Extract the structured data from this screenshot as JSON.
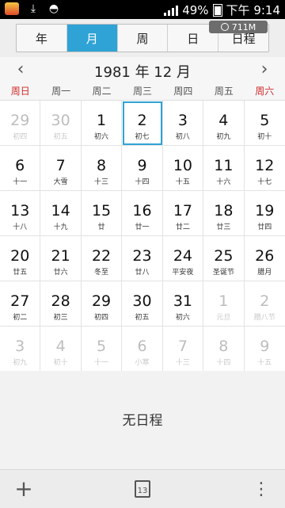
{
  "status": {
    "battery": "49%",
    "time": "下午 9:14"
  },
  "tabs": [
    {
      "label": "年",
      "active": false
    },
    {
      "label": "月",
      "active": true
    },
    {
      "label": "周",
      "active": false
    },
    {
      "label": "日",
      "active": false
    },
    {
      "label": "日程",
      "active": false
    }
  ],
  "memory_badge": "711M",
  "month_title": "1981 年 12 月",
  "weekdays": [
    "周日",
    "周一",
    "周二",
    "周三",
    "周四",
    "周五",
    "周六"
  ],
  "weeks": [
    [
      {
        "d": "29",
        "l": "初四",
        "dim": true
      },
      {
        "d": "30",
        "l": "初五",
        "dim": true
      },
      {
        "d": "1",
        "l": "初六"
      },
      {
        "d": "2",
        "l": "初七",
        "today": true
      },
      {
        "d": "3",
        "l": "初八"
      },
      {
        "d": "4",
        "l": "初九"
      },
      {
        "d": "5",
        "l": "初十"
      }
    ],
    [
      {
        "d": "6",
        "l": "十一"
      },
      {
        "d": "7",
        "l": "大雪"
      },
      {
        "d": "8",
        "l": "十三"
      },
      {
        "d": "9",
        "l": "十四"
      },
      {
        "d": "10",
        "l": "十五"
      },
      {
        "d": "11",
        "l": "十六"
      },
      {
        "d": "12",
        "l": "十七"
      }
    ],
    [
      {
        "d": "13",
        "l": "十八"
      },
      {
        "d": "14",
        "l": "十九"
      },
      {
        "d": "15",
        "l": "廿"
      },
      {
        "d": "16",
        "l": "廿一"
      },
      {
        "d": "17",
        "l": "廿二"
      },
      {
        "d": "18",
        "l": "廿三"
      },
      {
        "d": "19",
        "l": "廿四"
      }
    ],
    [
      {
        "d": "20",
        "l": "廿五"
      },
      {
        "d": "21",
        "l": "廿六"
      },
      {
        "d": "22",
        "l": "冬至"
      },
      {
        "d": "23",
        "l": "廿八"
      },
      {
        "d": "24",
        "l": "平安夜"
      },
      {
        "d": "25",
        "l": "圣诞节"
      },
      {
        "d": "26",
        "l": "腊月"
      }
    ],
    [
      {
        "d": "27",
        "l": "初二"
      },
      {
        "d": "28",
        "l": "初三"
      },
      {
        "d": "29",
        "l": "初四"
      },
      {
        "d": "30",
        "l": "初五"
      },
      {
        "d": "31",
        "l": "初六"
      },
      {
        "d": "1",
        "l": "元旦",
        "dim": true
      },
      {
        "d": "2",
        "l": "腊八节",
        "dim": true
      }
    ],
    [
      {
        "d": "3",
        "l": "初九",
        "dim": true
      },
      {
        "d": "4",
        "l": "初十",
        "dim": true
      },
      {
        "d": "5",
        "l": "十一",
        "dim": true
      },
      {
        "d": "6",
        "l": "小寒",
        "dim": true
      },
      {
        "d": "7",
        "l": "十三",
        "dim": true
      },
      {
        "d": "8",
        "l": "十四",
        "dim": true
      },
      {
        "d": "9",
        "l": "十五",
        "dim": true
      }
    ]
  ],
  "empty_text": "无日程",
  "bottom": {
    "calendar_day": "13"
  },
  "colors": {
    "accent": "#2fa3d6",
    "weekend_red": "#d12a2a"
  }
}
